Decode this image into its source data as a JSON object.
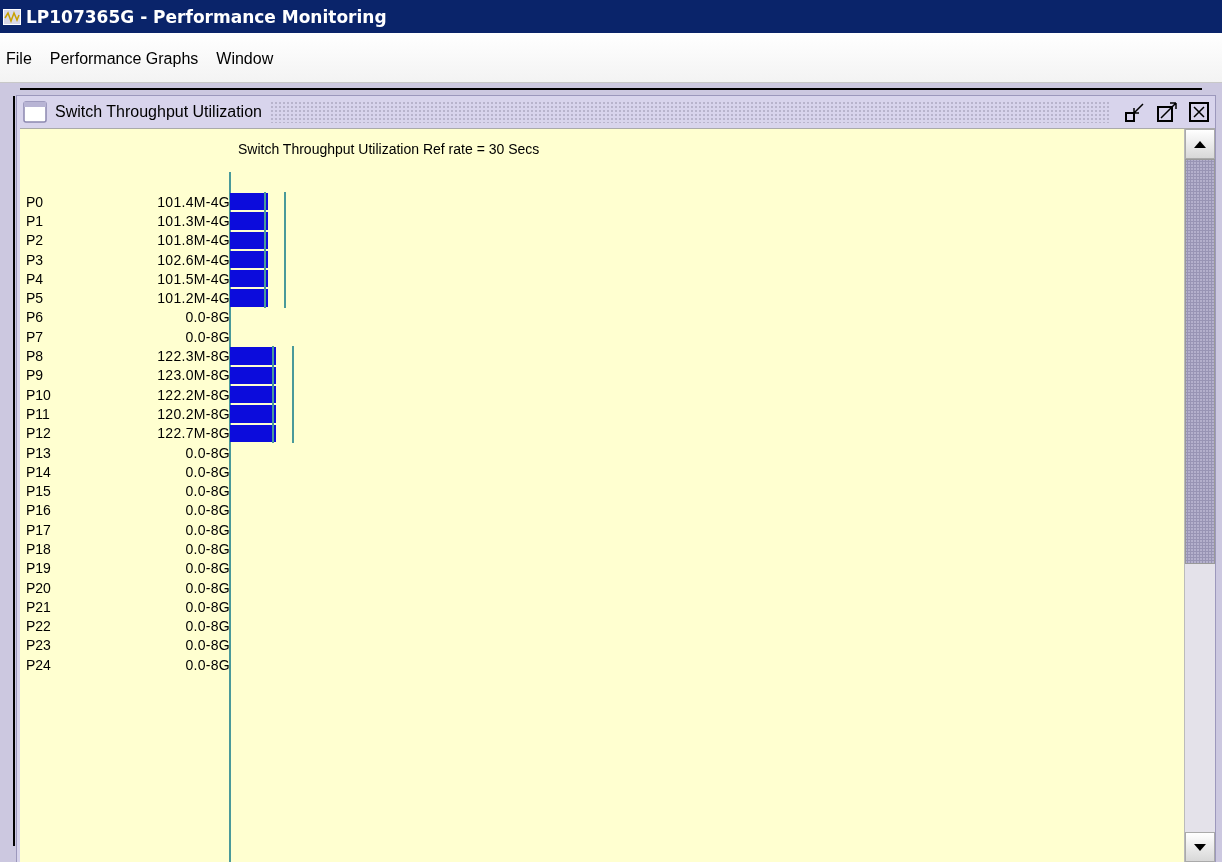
{
  "window": {
    "title": "LP107365G - Performance Monitoring"
  },
  "menu": [
    {
      "label": "File"
    },
    {
      "label": "Performance Graphs"
    },
    {
      "label": "Window"
    }
  ],
  "internal_frame": {
    "title": "Switch Throughput Utilization"
  },
  "chart": {
    "heading": "Switch Throughput Utilization Ref rate = 30 Secs",
    "ports": [
      {
        "port": "P0",
        "reading": "101.4M-4G",
        "kind": "short"
      },
      {
        "port": "P1",
        "reading": "101.3M-4G",
        "kind": "short"
      },
      {
        "port": "P2",
        "reading": "101.8M-4G",
        "kind": "short"
      },
      {
        "port": "P3",
        "reading": "102.6M-4G",
        "kind": "short"
      },
      {
        "port": "P4",
        "reading": "101.5M-4G",
        "kind": "short"
      },
      {
        "port": "P5",
        "reading": "101.2M-4G",
        "kind": "short"
      },
      {
        "port": "P6",
        "reading": "0.0-8G",
        "kind": "idle"
      },
      {
        "port": "P7",
        "reading": "0.0-8G",
        "kind": "idle"
      },
      {
        "port": "P8",
        "reading": "122.3M-8G",
        "kind": "long"
      },
      {
        "port": "P9",
        "reading": "123.0M-8G",
        "kind": "long"
      },
      {
        "port": "P10",
        "reading": "122.2M-8G",
        "kind": "long"
      },
      {
        "port": "P11",
        "reading": "120.2M-8G",
        "kind": "long"
      },
      {
        "port": "P12",
        "reading": "122.7M-8G",
        "kind": "long"
      },
      {
        "port": "P13",
        "reading": "0.0-8G",
        "kind": "idle"
      },
      {
        "port": "P14",
        "reading": "0.0-8G",
        "kind": "idle"
      },
      {
        "port": "P15",
        "reading": "0.0-8G",
        "kind": "idle"
      },
      {
        "port": "P16",
        "reading": "0.0-8G",
        "kind": "idle"
      },
      {
        "port": "P17",
        "reading": "0.0-8G",
        "kind": "idle"
      },
      {
        "port": "P18",
        "reading": "0.0-8G",
        "kind": "idle"
      },
      {
        "port": "P19",
        "reading": "0.0-8G",
        "kind": "idle"
      },
      {
        "port": "P20",
        "reading": "0.0-8G",
        "kind": "idle"
      },
      {
        "port": "P21",
        "reading": "0.0-8G",
        "kind": "idle"
      },
      {
        "port": "P22",
        "reading": "0.0-8G",
        "kind": "idle"
      },
      {
        "port": "P23",
        "reading": "0.0-8G",
        "kind": "idle"
      },
      {
        "port": "P24",
        "reading": "0.0-8G",
        "kind": "idle"
      }
    ]
  }
}
